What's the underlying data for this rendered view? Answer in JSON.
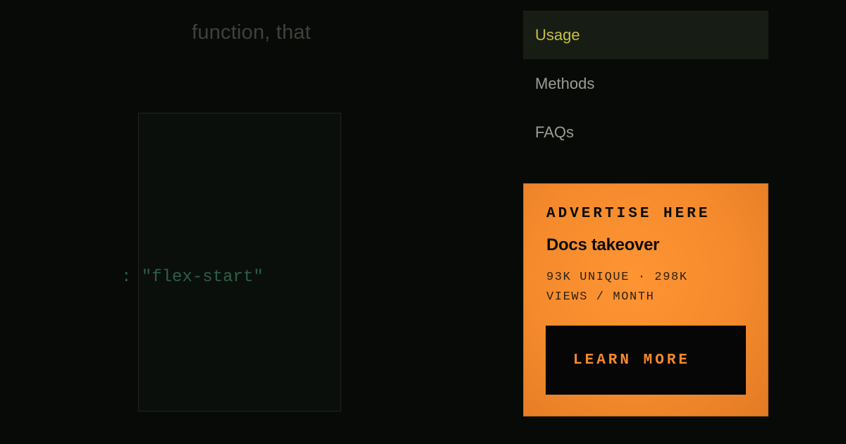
{
  "background": {
    "paragraph_fragment": "function, that",
    "code_fragment": ": \"flex-start\""
  },
  "nav": {
    "items": [
      {
        "label": "Usage",
        "active": true
      },
      {
        "label": "Methods",
        "active": false
      },
      {
        "label": "FAQs",
        "active": false
      }
    ]
  },
  "ad": {
    "eyebrow": "ADVERTISE HERE",
    "title": "Docs takeover",
    "stats_line1": "93K UNIQUE · 298K",
    "stats_line2": "VIEWS / MONTH",
    "button_label": "LEARN MORE"
  },
  "colors": {
    "background": "#070a06",
    "nav_active_text": "#c8c03a",
    "ad_orange": "#f48a2c",
    "ad_button_bg": "#060606"
  }
}
